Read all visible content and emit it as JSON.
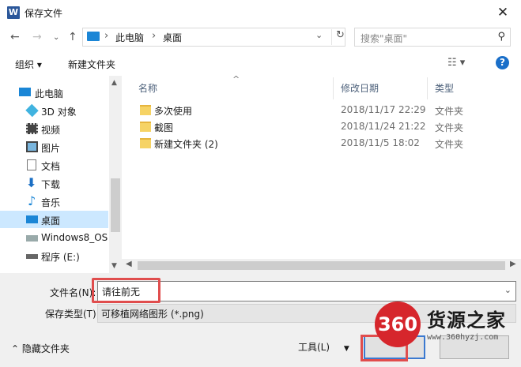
{
  "window": {
    "app_icon_letter": "W",
    "title": "保存文件"
  },
  "address": {
    "segments": [
      "此电脑",
      "桌面"
    ],
    "search_placeholder": "搜索\"桌面\""
  },
  "toolbar": {
    "organize_label": "组织 ▾",
    "new_folder_label": "新建文件夹"
  },
  "nav_pane": {
    "items": [
      {
        "label": "此电脑",
        "icon": "computer-icon"
      },
      {
        "label": "3D 对象",
        "icon": "cube-icon"
      },
      {
        "label": "视频",
        "icon": "film-icon"
      },
      {
        "label": "图片",
        "icon": "picture-icon"
      },
      {
        "label": "文档",
        "icon": "document-icon"
      },
      {
        "label": "下载",
        "icon": "download-icon"
      },
      {
        "label": "音乐",
        "icon": "music-icon"
      },
      {
        "label": "桌面",
        "icon": "desktop-icon",
        "selected": true
      },
      {
        "label": "Windows8_OS",
        "icon": "drive-icon"
      },
      {
        "label": "程序 (E:)",
        "icon": "drive-icon"
      }
    ]
  },
  "file_list": {
    "columns": [
      "名称",
      "修改日期",
      "类型"
    ],
    "rows": [
      {
        "name": "多次使用",
        "date": "2018/11/17 22:29",
        "type": "文件夹"
      },
      {
        "name": "截图",
        "date": "2018/11/24 21:22",
        "type": "文件夹"
      },
      {
        "name": "新建文件夹 (2)",
        "date": "2018/11/5 18:02",
        "type": "文件夹"
      }
    ]
  },
  "form": {
    "filename_label": "文件名(N):",
    "filename_value": "请往前无",
    "filetype_label": "保存类型(T):",
    "filetype_value": "可移植网络图形 (*.png)"
  },
  "footer": {
    "hide_folders_label": "隐藏文件夹",
    "tools_label": "工具(L)"
  },
  "watermark": {
    "logo_text": "360",
    "title": "货源之家",
    "url": "www.360hyzj.com"
  },
  "colors": {
    "accent": "#1a6fc9",
    "selection": "#cce8ff",
    "highlight": "#e04d4d",
    "watermark_red": "#d6262c"
  }
}
